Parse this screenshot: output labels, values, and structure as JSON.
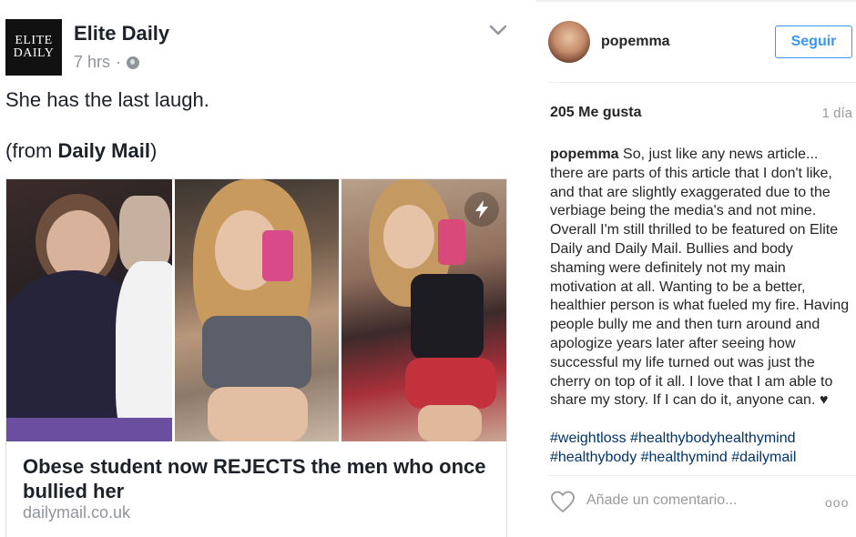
{
  "facebook_post": {
    "page_logo_text": [
      "ELITE",
      "DAILY"
    ],
    "page_name": "Elite Daily",
    "timestamp": "7 hrs",
    "separator": "·",
    "post_text": "She has the last laugh.",
    "source_prefix": "(from ",
    "source_name": "Daily Mail",
    "source_suffix": ")",
    "link_card": {
      "headline": "Obese student now REJECTS the men who once bullied her",
      "domain": "dailymail.co.uk"
    },
    "icons": [
      "globe-icon",
      "chevron-down-icon",
      "lightning-bolt-icon"
    ]
  },
  "instagram_post": {
    "username": "popemma",
    "follow_label": "Seguir",
    "likes": "205 Me gusta",
    "time_ago": "1 día",
    "caption_user": "popemma",
    "caption_text": "So, just like any news article... there are parts of this article that I don't like, and that are slightly exaggerated due to the verbiage being the media's and not mine. Overall I'm still thrilled to be featured on Elite Daily and Daily Mail. Bullies and body shaming were definitely not my main motivation at all. Wanting to be a better, healthier person is what fueled my fire. Having people bully me and then turn around and apologize years later after seeing how successful my life turned out was just the cherry on top of it all. I love that I am able to share my story. If I can do it, anyone can. ♥",
    "hashtags": "#weightloss #healthybodyhealthymind #healthybody #healthymind #dailymail",
    "comment_placeholder": "Añade un comentario...",
    "more_label": "ooo",
    "colors": {
      "follow_blue": "#3897f0",
      "hashtag_blue": "#003569",
      "muted": "#999999"
    },
    "icons": [
      "heart-outline-icon",
      "more-options-icon"
    ]
  }
}
